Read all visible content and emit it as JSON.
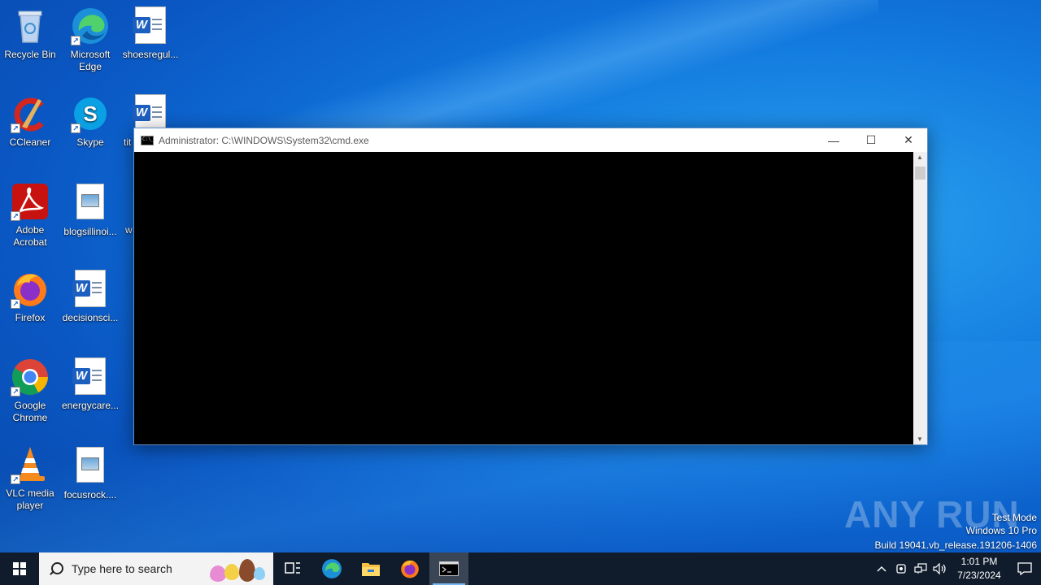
{
  "desktop": {
    "icons": [
      {
        "label": "Recycle Bin"
      },
      {
        "label": "Microsoft Edge"
      },
      {
        "label": "shoesregul..."
      },
      {
        "label": "CCleaner"
      },
      {
        "label": "Skype"
      },
      {
        "label": "tit"
      },
      {
        "label": "Adobe Acrobat"
      },
      {
        "label": "blogsillinoi..."
      },
      {
        "label": "w"
      },
      {
        "label": "Firefox"
      },
      {
        "label": "decisionsci..."
      },
      {
        "label": "Google Chrome"
      },
      {
        "label": "energycare..."
      },
      {
        "label": "VLC media player"
      },
      {
        "label": "focusrock...."
      }
    ]
  },
  "cmd_window": {
    "title": "Administrator: C:\\WINDOWS\\System32\\cmd.exe",
    "minimize_glyph": "—",
    "maximize_glyph": "☐",
    "close_glyph": "✕"
  },
  "watermark": {
    "brand": "ANY RUN",
    "test_mode": "Test Mode",
    "edition": "Windows 10 Pro",
    "build": "Build 19041.vb_release.191206-1406"
  },
  "taskbar": {
    "search_placeholder": "Type here to search",
    "pinned": [
      "task-view",
      "microsoft-edge",
      "file-explorer",
      "firefox",
      "cmd"
    ],
    "active_app": "cmd",
    "clock_time": "1:01 PM",
    "clock_date": "7/23/2024"
  },
  "colors": {
    "desktop_blue": "#0a56c2",
    "taskbar_bg": "#101c2c",
    "console_bg": "#000000",
    "active_indicator": "#79b8f1"
  }
}
